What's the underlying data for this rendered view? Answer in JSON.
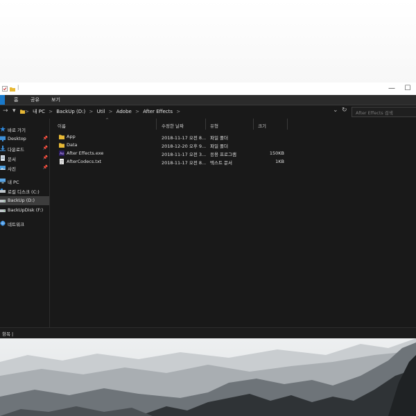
{
  "window": {
    "ribbon_tabs": [
      "홈",
      "공유",
      "보기"
    ],
    "controls": {
      "minimize": "—",
      "maximize": "☐"
    }
  },
  "address": {
    "back": "→",
    "dropdown": "▾",
    "path": [
      "내 PC",
      "BackUp (D:)",
      "Util",
      "Adobe",
      "After Effects"
    ],
    "separator": ">",
    "recent": "⌄",
    "refresh": "↻",
    "search_placeholder": "After Effects 검색"
  },
  "nav": {
    "items": [
      {
        "label": "바로 가기",
        "icon": "star-icon",
        "pinned": false
      },
      {
        "label": "Desktop",
        "icon": "desktop-icon",
        "pinned": true
      },
      {
        "label": "다운로드",
        "icon": "download-icon",
        "pinned": true
      },
      {
        "label": "문서",
        "icon": "document-icon",
        "pinned": true
      },
      {
        "label": "사진",
        "icon": "picture-icon",
        "pinned": true
      },
      {
        "label": "내 PC",
        "icon": "computer-icon",
        "pinned": false
      },
      {
        "label": "로컬 디스크 (C:)",
        "icon": "drive-icon",
        "pinned": false
      },
      {
        "label": "BackUp (D:)",
        "icon": "drive-icon",
        "pinned": false,
        "selected": true
      },
      {
        "label": "BackUpDisk (F:)",
        "icon": "drive-icon",
        "pinned": false
      },
      {
        "label": "네트워크",
        "icon": "network-icon",
        "pinned": false
      }
    ]
  },
  "columns": [
    "이름",
    "수정한 날짜",
    "유형",
    "크기"
  ],
  "files": [
    {
      "name": "App",
      "date": "2018-11-17 오전 8...",
      "type": "파일 폴더",
      "size": "",
      "icon": "folder-icon"
    },
    {
      "name": "Data",
      "date": "2018-12-20 오후 9...",
      "type": "파일 폴더",
      "size": "",
      "icon": "folder-icon"
    },
    {
      "name": "After Effects.exe",
      "date": "2018-11-17 오전 3...",
      "type": "응용 프로그램",
      "size": "150KB",
      "icon": "exe-icon"
    },
    {
      "name": "AfterCodecs.txt",
      "date": "2018-11-17 오전 8...",
      "type": "텍스트 문서",
      "size": "1KB",
      "icon": "text-file-icon"
    }
  ],
  "status": {
    "text": "항목 |"
  },
  "colors": {
    "accent": "#1979ca",
    "folder": "#e8b935",
    "window_bg": "#191919"
  }
}
